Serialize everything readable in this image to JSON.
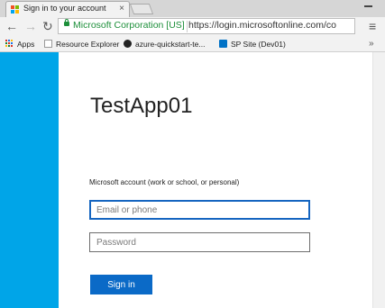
{
  "browser": {
    "tab": {
      "title": "Sign in to your account",
      "close": "×",
      "favicon_colors": [
        "#f25022",
        "#7fba00",
        "#00a4ef",
        "#ffb900"
      ]
    },
    "nav": {
      "back": "←",
      "forward": "→",
      "reload": "↻",
      "menu": "≡"
    },
    "address_bar": {
      "ev_label": "Microsoft Corporation [US]",
      "url": "https://login.microsoftonline.com/co",
      "ev_color": "#1d8f3a"
    },
    "bookmarks": {
      "items": [
        {
          "label": "Apps",
          "icon": "apps-grid-icon"
        },
        {
          "label": "Resource Explorer",
          "icon": "page-icon"
        },
        {
          "label": "azure-quickstart-te...",
          "icon": "github-icon"
        },
        {
          "label": "SP Site (Dev01)",
          "icon": "sharepoint-icon"
        }
      ],
      "overflow": "»"
    }
  },
  "signin": {
    "app_name": "TestApp01",
    "account_label": "Microsoft account (work or school, or personal)",
    "email_placeholder": "Email or phone",
    "password_placeholder": "Password",
    "submit_label": "Sign in",
    "accent_color": "#0b6ac7",
    "banner_color": "#00a5e8"
  }
}
